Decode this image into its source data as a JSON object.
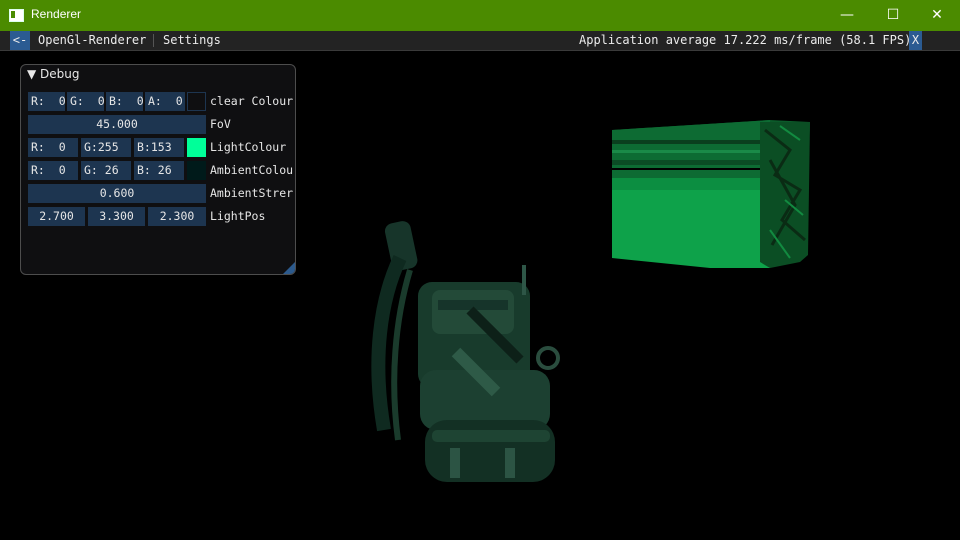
{
  "window": {
    "title": "Renderer",
    "controls": {
      "minimize": "—",
      "maximize": "☐",
      "close": "✕"
    }
  },
  "menubar": {
    "back": "<-",
    "items": [
      "OpenGl-Renderer",
      "Settings"
    ],
    "status": "Application average 17.222 ms/frame (58.1 FPS)",
    "close": "X"
  },
  "debug_panel": {
    "title": "▼ Debug",
    "clear_colour": {
      "r": "R:  0",
      "g": "G:  0",
      "b": "B:  0",
      "a": "A:  0",
      "swatch_color": "#000000",
      "label": "clear Colour"
    },
    "fov": {
      "value": "45.000",
      "label": "FoV"
    },
    "light_colour": {
      "r": "R:  0",
      "g": "G:255",
      "b": "B:153",
      "swatch_color": "#00ff99",
      "label": "LightColour"
    },
    "ambient_colour": {
      "r": "R:  0",
      "g": "G: 26",
      "b": "B: 26",
      "swatch_color": "#001a1a",
      "label": "AmbientColou"
    },
    "ambient_strength": {
      "value": "0.600",
      "label": "AmbientStrer"
    },
    "light_pos": {
      "x": "2.700",
      "y": "3.300",
      "z": "2.300",
      "label": "LightPos"
    }
  },
  "colors": {
    "titlebar": "#4b8b00",
    "accent": "#2b5b92",
    "field": "#1d3550"
  }
}
